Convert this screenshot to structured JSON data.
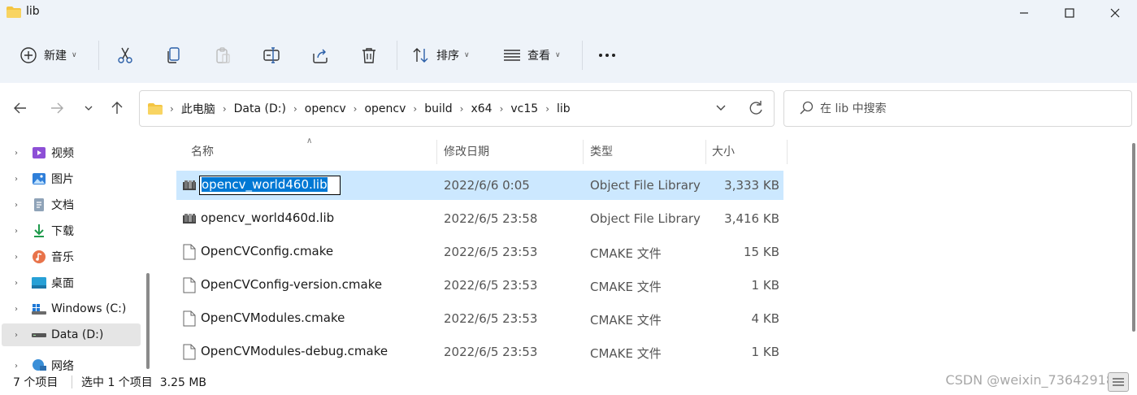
{
  "window": {
    "title": "lib"
  },
  "toolbar": {
    "new_label": "新建",
    "sort_label": "排序",
    "view_label": "查看"
  },
  "address": {
    "crumbs": [
      "此电脑",
      "Data (D:)",
      "opencv",
      "opencv",
      "build",
      "x64",
      "vc15",
      "lib"
    ]
  },
  "search": {
    "placeholder": "在 lib 中搜索"
  },
  "sidebar": {
    "items": [
      {
        "label": "视频",
        "icon": "video-icon"
      },
      {
        "label": "图片",
        "icon": "pictures-icon"
      },
      {
        "label": "文档",
        "icon": "documents-icon"
      },
      {
        "label": "下载",
        "icon": "downloads-icon"
      },
      {
        "label": "音乐",
        "icon": "music-icon"
      },
      {
        "label": "桌面",
        "icon": "desktop-icon"
      },
      {
        "label": "Windows (C:)",
        "icon": "windows-drive-icon"
      },
      {
        "label": "Data (D:)",
        "icon": "drive-icon",
        "selected": true
      },
      {
        "label": "网络",
        "icon": "network-icon"
      }
    ]
  },
  "columns": {
    "name": "名称",
    "date": "修改日期",
    "type": "类型",
    "size": "大小"
  },
  "files": [
    {
      "name": "opencv_world460.lib",
      "date": "2022/6/6 0:05",
      "type": "Object File Library",
      "size": "3,333 KB",
      "icon": "library-file-icon",
      "selected": true
    },
    {
      "name": "opencv_world460d.lib",
      "date": "2022/6/5 23:58",
      "type": "Object File Library",
      "size": "3,416 KB",
      "icon": "library-file-icon"
    },
    {
      "name": "OpenCVConfig.cmake",
      "date": "2022/6/5 23:53",
      "type": "CMAKE 文件",
      "size": "15 KB",
      "icon": "generic-file-icon"
    },
    {
      "name": "OpenCVConfig-version.cmake",
      "date": "2022/6/5 23:53",
      "type": "CMAKE 文件",
      "size": "1 KB",
      "icon": "generic-file-icon"
    },
    {
      "name": "OpenCVModules.cmake",
      "date": "2022/6/5 23:53",
      "type": "CMAKE 文件",
      "size": "4 KB",
      "icon": "generic-file-icon"
    },
    {
      "name": "OpenCVModules-debug.cmake",
      "date": "2022/6/5 23:53",
      "type": "CMAKE 文件",
      "size": "1 KB",
      "icon": "generic-file-icon"
    }
  ],
  "status": {
    "item_count": "7 个项目",
    "selection": "选中 1 个项目  3.25 MB",
    "watermark": "CSDN @weixin_73642918"
  },
  "colors": {
    "selection": "#cce8ff",
    "accent": "#0078d4",
    "chrome": "#eef3f9"
  }
}
